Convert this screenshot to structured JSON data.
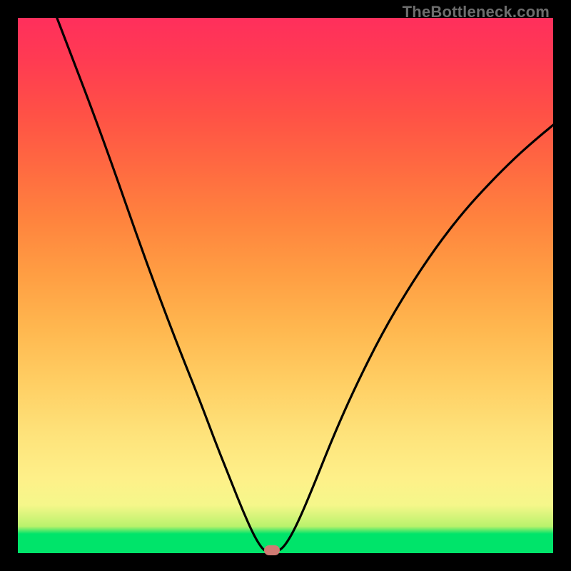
{
  "watermark": "TheBottleneck.com",
  "colors": {
    "frame": "#000000",
    "marker": "#cf7a73",
    "curve": "#000000",
    "watermark_text": "#6d6d6d",
    "gradient_stops": [
      "#00e46a",
      "#b9f26c",
      "#fef089",
      "#ffce63",
      "#ff9e43",
      "#ff6a41",
      "#ff3b52",
      "#ff2f5c"
    ]
  },
  "chart_data": {
    "type": "line",
    "title": "",
    "xlabel": "",
    "ylabel": "",
    "xlim": [
      0,
      100
    ],
    "ylim": [
      0,
      100
    ],
    "grid": false,
    "legend": false,
    "curve": [
      {
        "x": 7.3,
        "y": 100.0
      },
      {
        "x": 10.0,
        "y": 93.0
      },
      {
        "x": 14.0,
        "y": 82.5
      },
      {
        "x": 18.0,
        "y": 71.5
      },
      {
        "x": 22.0,
        "y": 60.0
      },
      {
        "x": 26.0,
        "y": 49.0
      },
      {
        "x": 30.0,
        "y": 38.5
      },
      {
        "x": 34.0,
        "y": 28.5
      },
      {
        "x": 37.0,
        "y": 20.5
      },
      {
        "x": 40.0,
        "y": 13.0
      },
      {
        "x": 42.0,
        "y": 8.0
      },
      {
        "x": 44.0,
        "y": 3.5
      },
      {
        "x": 45.5,
        "y": 1.0
      },
      {
        "x": 46.5,
        "y": 0.2
      },
      {
        "x": 48.5,
        "y": 0.2
      },
      {
        "x": 50.0,
        "y": 1.5
      },
      {
        "x": 52.0,
        "y": 5.0
      },
      {
        "x": 55.0,
        "y": 12.0
      },
      {
        "x": 59.0,
        "y": 22.0
      },
      {
        "x": 63.0,
        "y": 31.0
      },
      {
        "x": 68.0,
        "y": 41.0
      },
      {
        "x": 73.0,
        "y": 49.5
      },
      {
        "x": 78.0,
        "y": 57.0
      },
      {
        "x": 83.0,
        "y": 63.5
      },
      {
        "x": 88.0,
        "y": 69.0
      },
      {
        "x": 93.0,
        "y": 74.0
      },
      {
        "x": 97.0,
        "y": 77.5
      },
      {
        "x": 100.0,
        "y": 80.0
      }
    ],
    "marker": {
      "x": 47.5,
      "y": 0.5
    }
  }
}
